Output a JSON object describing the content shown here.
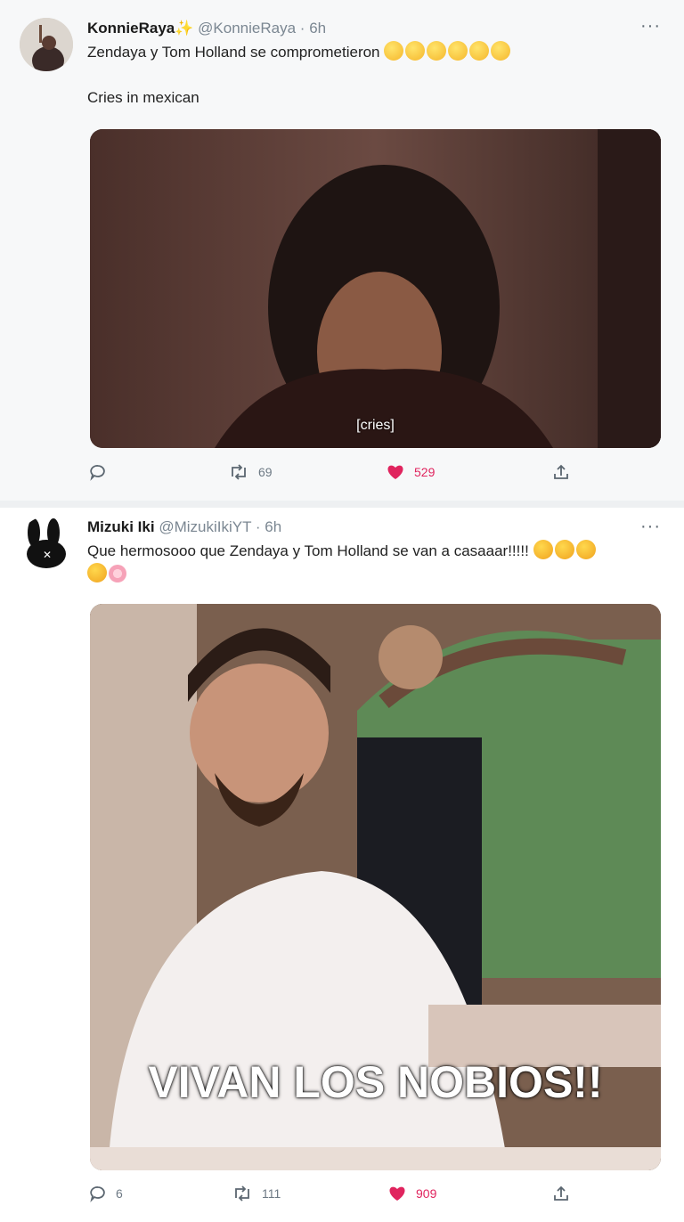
{
  "tweets": [
    {
      "name": "KonnieRaya",
      "handle": "@KonnieRaya",
      "separator": "·",
      "time": "6h",
      "text_line1": "Zendaya y Tom Holland se comprometieron",
      "text_line2": "Cries in mexican",
      "media_caption": "[cries]",
      "replies": "",
      "retweets": "69",
      "likes": "529",
      "more_label": "···"
    },
    {
      "name": "Mizuki Iki",
      "handle": "@MizukiIkiYT",
      "separator": "·",
      "time": "6h",
      "text_line1": "Que hermosooo que Zendaya y Tom Holland se van a casaaar!!!!!",
      "media_caption": "VIVAN LOS NOBIOS!!",
      "replies": "6",
      "retweets": "111",
      "likes": "909",
      "more_label": "···"
    }
  ],
  "colors": {
    "like": "#e0245e",
    "muted": "#7b8792"
  },
  "icons": [
    "reply-icon",
    "retweet-icon",
    "heart-icon",
    "share-icon",
    "more-icon",
    "sparkles-icon",
    "crying-emoji",
    "party-emoji",
    "flower-emoji"
  ]
}
